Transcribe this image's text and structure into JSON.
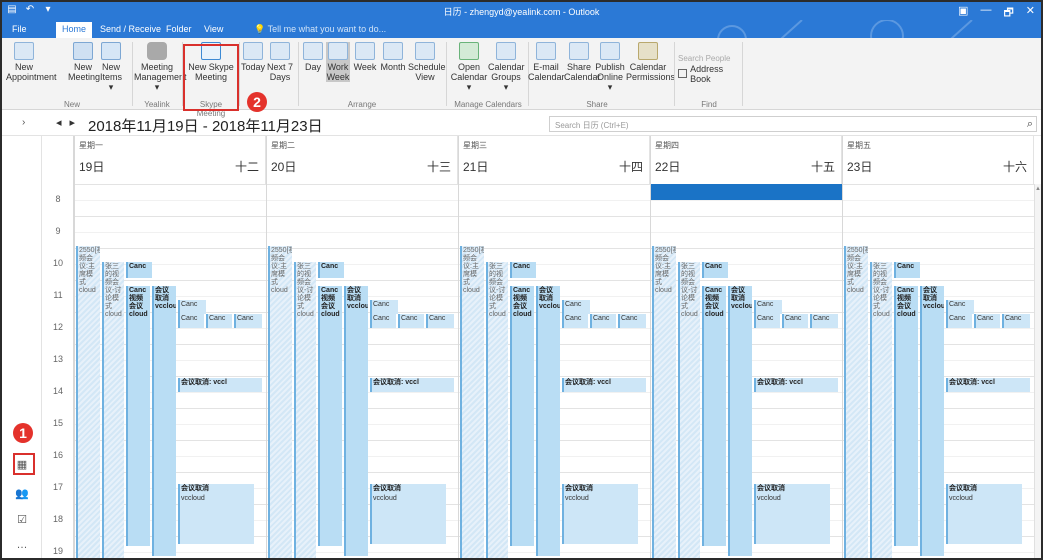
{
  "window": {
    "title": "日历 - zhengyd@yealink.com - Outlook",
    "controls": [
      "▣",
      "—",
      "🗗",
      "✕"
    ]
  },
  "tabs": [
    "File",
    "Home",
    "Send / Receive",
    "Folder",
    "View"
  ],
  "active_tab": "Home",
  "tell_me": "Tell me what you want to do...",
  "ribbon": {
    "new_appointment": "New\nAppointment",
    "new_meeting": "New\nMeeting",
    "new_items": "New\nItems ▾",
    "group_new": "New",
    "meeting_management": "Meeting\nManagement ▾",
    "group_yealink": "Yealink",
    "new_skype_meeting": "New Skype\nMeeting",
    "group_skype": "Skype Meeting",
    "today": "Today",
    "next7": "Next 7\nDays",
    "day": "Day",
    "work_week": "Work\nWeek",
    "week": "Week",
    "month": "Month",
    "schedule_view": "Schedule\nView",
    "group_arrange": "Arrange",
    "open_calendar": "Open\nCalendar ▾",
    "calendar_groups": "Calendar\nGroups ▾",
    "group_manage": "Manage Calendars",
    "email_calendar": "E-mail\nCalendar",
    "share_calendar": "Share\nCalendar",
    "publish_online": "Publish\nOnline ▾",
    "calendar_permissions": "Calendar\nPermissions",
    "group_share": "Share",
    "search_people": "Search People",
    "address_book": "Address Book",
    "group_find": "Find"
  },
  "badges": {
    "one": "1",
    "two": "2"
  },
  "date_range": "2018年11月19日 - 2018年11月23日",
  "calendar_search": "Search 日历 (Ctrl+E)",
  "days": [
    {
      "weekday": "星期一",
      "date": "19日",
      "lunar": "十二"
    },
    {
      "weekday": "星期二",
      "date": "20日",
      "lunar": "十三"
    },
    {
      "weekday": "星期三",
      "date": "21日",
      "lunar": "十四"
    },
    {
      "weekday": "星期四",
      "date": "22日",
      "lunar": "十五"
    },
    {
      "weekday": "星期五",
      "date": "23日",
      "lunar": "十六"
    }
  ],
  "hours": [
    "8",
    "9",
    "10",
    "11",
    "12",
    "13",
    "14",
    "15",
    "16",
    "17",
    "18",
    "19"
  ],
  "event_text": {
    "e2550": "2550[视频会议:主席模式 cloud",
    "zhangsan": "张三的视频会议-讨论模式 cloud",
    "canc": "Canc",
    "canc_video": "Canc 视频 会议 cloud",
    "meet_cancel": "会议取消 vcclou",
    "cancel_bar": "会议取消: vccl",
    "cancel_block": "会议取消",
    "vccloud": "vccloud"
  },
  "colors": {
    "accent": "#2b79d6",
    "event": "#cde6f7",
    "highlight": "#d9302c",
    "selected": "#1a73c6"
  }
}
